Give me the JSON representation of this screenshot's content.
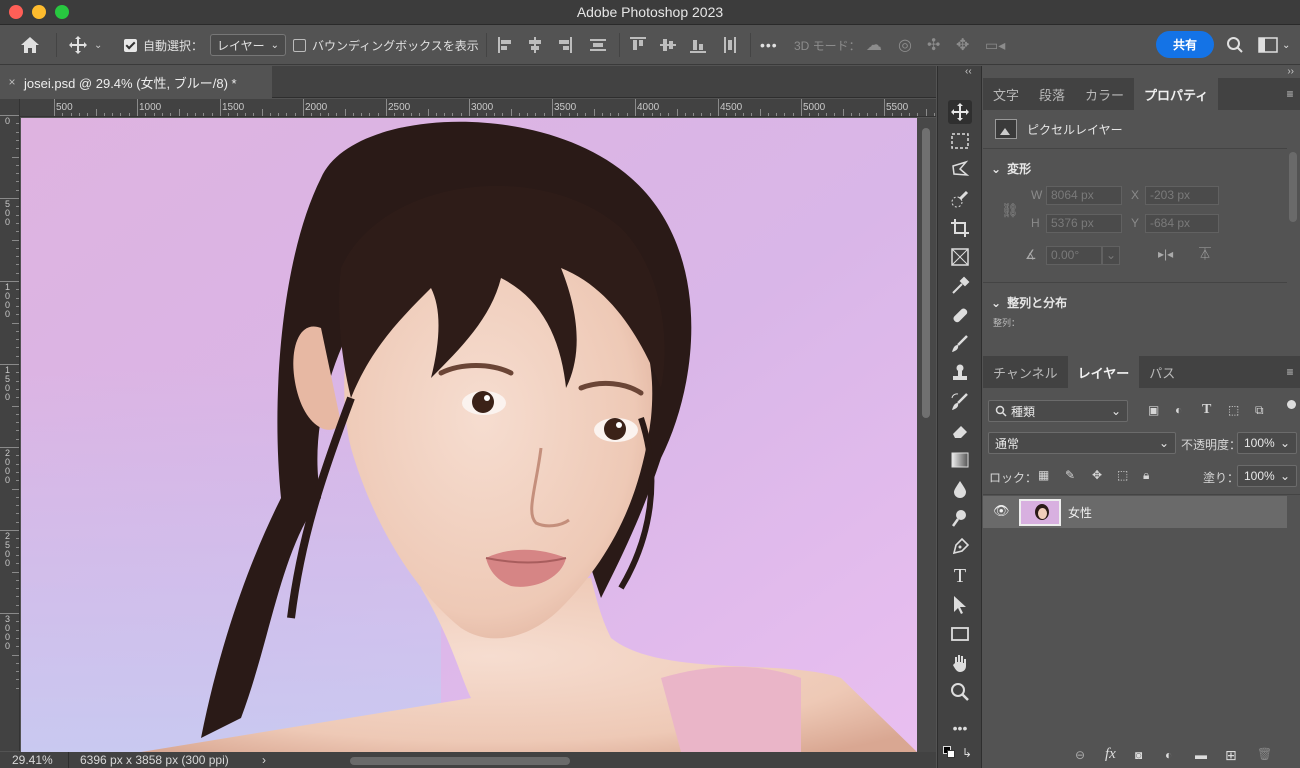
{
  "window": {
    "title": "Adobe Photoshop 2023"
  },
  "options_bar": {
    "auto_select_label": "自動選択：",
    "auto_select_target": "レイヤー",
    "bounding_box_label": "バウンディングボックスを表示",
    "more": "•••",
    "mode_3d_label": "3D モード：",
    "share_label": "共有"
  },
  "document": {
    "tab_title": "josei.psd @ 29.4% (女性, ブルー/8) *",
    "close": "×",
    "ruler_top": [
      "500",
      "1000",
      "1500",
      "2000",
      "2500",
      "3000",
      "3500",
      "4000",
      "4500",
      "5000",
      "5500"
    ],
    "ruler_left": [
      "0",
      "500",
      "1000",
      "1500",
      "2000",
      "2500",
      "3000"
    ]
  },
  "status": {
    "zoom": "29.41%",
    "info": "6396 px x 3858 px (300 ppi)",
    "arrow": "›"
  },
  "tools": [
    "move-tool",
    "marquee-tool",
    "lasso-tool",
    "quick-select-tool",
    "crop-tool",
    "frame-tool",
    "eyedropper-tool",
    "healing-tool",
    "brush-tool",
    "stamp-tool",
    "history-brush-tool",
    "eraser-tool",
    "gradient-tool",
    "blur-tool",
    "dodge-tool",
    "pen-tool",
    "type-tool",
    "path-select-tool",
    "rectangle-tool",
    "hand-tool",
    "zoom-tool",
    "more-tools"
  ],
  "properties_panel": {
    "tabs": [
      "文字",
      "段落",
      "カラー",
      "プロパティ"
    ],
    "active_tab": "プロパティ",
    "layer_type": "ピクセルレイヤー",
    "transform_title": "変形",
    "w_label": "W",
    "w_value": "8064 px",
    "h_label": "H",
    "h_value": "5376 px",
    "x_label": "X",
    "x_value": "-203 px",
    "y_label": "Y",
    "y_value": "-684 px",
    "angle_value": "0.00°",
    "align_title": "整列と分布",
    "align_sub": "整列："
  },
  "layers_panel": {
    "tabs": [
      "チャンネル",
      "レイヤー",
      "パス"
    ],
    "active_tab": "レイヤー",
    "filter_label": "種類",
    "blend_mode": "通常",
    "opacity_label": "不透明度：",
    "opacity_value": "100%",
    "lock_label": "ロック：",
    "fill_label": "塗り：",
    "fill_value": "100%",
    "layers": [
      {
        "name": "女性",
        "visible": true
      }
    ]
  },
  "colors": {
    "accent": "#1473e6",
    "bg_pink": "#e2b8e6",
    "bg_lavender": "#c9c6ef"
  }
}
